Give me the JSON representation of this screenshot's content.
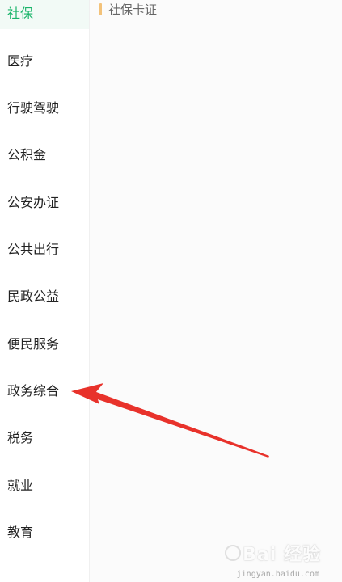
{
  "sidebar": {
    "items": [
      {
        "label": "社保",
        "active": true
      },
      {
        "label": "医疗"
      },
      {
        "label": "行驶驾驶"
      },
      {
        "label": "公积金"
      },
      {
        "label": "公安办证"
      },
      {
        "label": "公共出行"
      },
      {
        "label": "民政公益"
      },
      {
        "label": "便民服务"
      },
      {
        "label": "政务综合"
      },
      {
        "label": "税务"
      },
      {
        "label": "就业"
      },
      {
        "label": "教育"
      }
    ]
  },
  "content": {
    "section_title": "社保卡证"
  },
  "annotation": {
    "arrow_color": "#e8322b"
  },
  "watermark": {
    "brand": "Bai 经验",
    "url": "jingyan.baidu.com"
  },
  "colors": {
    "active_text": "#1ab46a",
    "active_bg": "#f2faf6",
    "section_bar": "#f3c27a"
  }
}
